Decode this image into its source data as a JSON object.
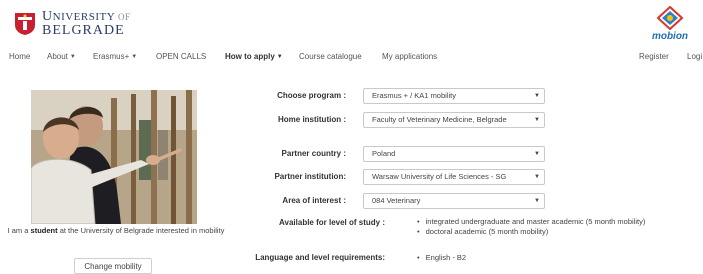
{
  "brand": {
    "university_first": "NIVERSITY",
    "university_cap": "U",
    "university_of": "OF",
    "university_city": "BELGRADE",
    "mobion": "mobion",
    "crest_color": "#c8202f",
    "mobion_color": "#1f6eb8"
  },
  "nav": {
    "home": "Home",
    "about": "About",
    "erasmus": "Erasmus+",
    "open_calls": "OPEN CALLS",
    "how_to_apply": "How to apply",
    "course_catalogue": "Course catalogue",
    "my_applications": "My applications",
    "register": "Register",
    "login": "Logi"
  },
  "profile": {
    "caption_prefix": "I am a",
    "caption_role": "student",
    "caption_suffix": "at the University of Belgrade interested in mobility",
    "change_button": "Change mobility"
  },
  "form": {
    "program_label": "Choose program :",
    "program_value": "Erasmus + / KA1 mobility",
    "home_label": "Home institution :",
    "home_value": "Faculty of Veterinary Medicine, Belgrade",
    "country_label": "Partner country :",
    "country_value": "Poland",
    "partner_label": "Partner institution:",
    "partner_value": "Warsaw University of Life Sciences - SG",
    "area_label": "Area of interest :",
    "area_value": "084 Veterinary",
    "levels_label": "Available for level of study :",
    "levels": [
      "integrated undergraduate and master academic (5 month mobility)",
      "doctoral academic (5 month mobility)"
    ],
    "language_label": "Language and level requirements:",
    "language": [
      "English - B2"
    ]
  }
}
